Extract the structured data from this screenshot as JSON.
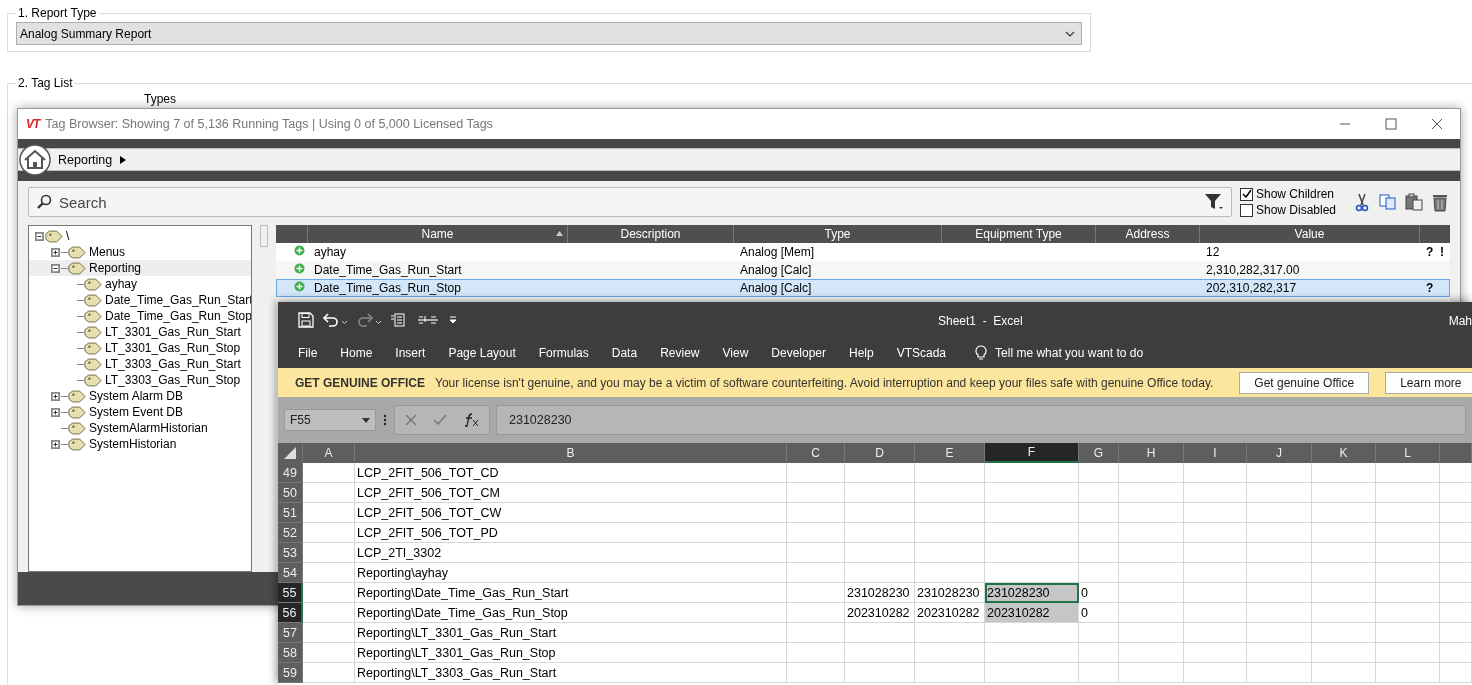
{
  "report_type": {
    "legend": "1. Report Type",
    "value": "Analog Summary Report"
  },
  "tag_list": {
    "legend": "2. Tag List",
    "types_label": "Types"
  },
  "tag_browser": {
    "logo_text": "VT",
    "title": "Tag Browser: Showing 7 of 5,136 Running Tags | Using 0 of 5,000 Licensed Tags",
    "breadcrumb": "Reporting",
    "search": {
      "placeholder": "Search"
    },
    "options": [
      {
        "label": "Show Children",
        "checked": true
      },
      {
        "label": "Show Disabled",
        "checked": false
      }
    ],
    "tree": [
      {
        "label": "\\",
        "expanded": true,
        "selected": false,
        "children": [
          {
            "label": "Menus",
            "expanded": false,
            "selected": false
          },
          {
            "label": "Reporting",
            "expanded": true,
            "selected": true,
            "children": [
              {
                "label": "ayhay",
                "selected": false
              },
              {
                "label": "Date_Time_Gas_Run_Start",
                "selected": false
              },
              {
                "label": "Date_Time_Gas_Run_Stop",
                "selected": false
              },
              {
                "label": "LT_3301_Gas_Run_Start",
                "selected": false
              },
              {
                "label": "LT_3301_Gas_Run_Stop",
                "selected": false
              },
              {
                "label": "LT_3303_Gas_Run_Start",
                "selected": false
              },
              {
                "label": "LT_3303_Gas_Run_Stop",
                "selected": false
              }
            ]
          },
          {
            "label": "System Alarm DB",
            "expanded": false,
            "selected": false
          },
          {
            "label": "System Event DB",
            "expanded": false,
            "selected": false
          },
          {
            "label": "SystemAlarmHistorian",
            "selected": false
          },
          {
            "label": "SystemHistorian",
            "expanded": false,
            "selected": false
          }
        ]
      }
    ],
    "columns": [
      {
        "label": "Name",
        "sorted": true
      },
      {
        "label": "Description",
        "sorted": false
      },
      {
        "label": "Type",
        "sorted": false
      },
      {
        "label": "Equipment Type",
        "sorted": false
      },
      {
        "label": "Address",
        "sorted": false
      },
      {
        "label": "Value",
        "sorted": false
      }
    ],
    "rows": [
      {
        "name": "ayhay",
        "type": "Analog [Mem]",
        "value": "12",
        "flags": [
          "?",
          "!"
        ],
        "selected": false
      },
      {
        "name": "Date_Time_Gas_Run_Start",
        "type": "Analog [Calc]",
        "value": "2,310,282,317.00",
        "flags": [],
        "selected": false
      },
      {
        "name": "Date_Time_Gas_Run_Stop",
        "type": "Analog [Calc]",
        "value": "202,310,282,317",
        "flags": [
          "?"
        ],
        "selected": true
      }
    ]
  },
  "excel": {
    "title": "Sheet1  -  Excel",
    "account": "Mah",
    "menu": [
      "File",
      "Home",
      "Insert",
      "Page Layout",
      "Formulas",
      "Data",
      "Review",
      "View",
      "Developer",
      "Help",
      "VTScada"
    ],
    "tell_me": "Tell me what you want to do",
    "notice": {
      "heading": "GET GENUINE OFFICE",
      "text": "Your license isn't genuine, and you may be a victim of software counterfeiting. Avoid interruption and keep your files safe with genuine Office today.",
      "buttons": [
        "Get genuine Office",
        "Learn more"
      ]
    },
    "name_box": "F55",
    "formula": "231028230",
    "columns": [
      {
        "label": "A",
        "selected": false
      },
      {
        "label": "B",
        "selected": false
      },
      {
        "label": "C",
        "selected": false
      },
      {
        "label": "D",
        "selected": false
      },
      {
        "label": "E",
        "selected": false
      },
      {
        "label": "F",
        "selected": true
      },
      {
        "label": "G",
        "selected": false
      },
      {
        "label": "H",
        "selected": false
      },
      {
        "label": "I",
        "selected": false
      },
      {
        "label": "J",
        "selected": false
      },
      {
        "label": "K",
        "selected": false
      },
      {
        "label": "L",
        "selected": false
      }
    ],
    "rows": [
      {
        "number": "49",
        "selected": false,
        "cells": {
          "B": "LCP_2FIT_506_TOT_CD"
        }
      },
      {
        "number": "50",
        "selected": false,
        "cells": {
          "B": "LCP_2FIT_506_TOT_CM"
        }
      },
      {
        "number": "51",
        "selected": false,
        "cells": {
          "B": "LCP_2FIT_506_TOT_CW"
        }
      },
      {
        "number": "52",
        "selected": false,
        "cells": {
          "B": "LCP_2FIT_506_TOT_PD"
        }
      },
      {
        "number": "53",
        "selected": false,
        "cells": {
          "B": "LCP_2TI_3302"
        }
      },
      {
        "number": "54",
        "selected": false,
        "cells": {
          "B": "Reporting\\ayhay"
        }
      },
      {
        "number": "55",
        "selected": true,
        "active": true,
        "cells": {
          "B": "Reporting\\Date_Time_Gas_Run_Start",
          "D": "231028230",
          "E": "231028230",
          "F": "231028230",
          "G": "0"
        }
      },
      {
        "number": "56",
        "selected": true,
        "active": false,
        "cells": {
          "B": "Reporting\\Date_Time_Gas_Run_Stop",
          "D": "202310282",
          "E": "202310282",
          "F": "202310282",
          "G": "0"
        }
      },
      {
        "number": "57",
        "selected": false,
        "cells": {
          "B": "Reporting\\LT_3301_Gas_Run_Start"
        }
      },
      {
        "number": "58",
        "selected": false,
        "cells": {
          "B": "Reporting\\LT_3301_Gas_Run_Stop"
        }
      },
      {
        "number": "59",
        "selected": false,
        "cells": {
          "B": "Reporting\\LT_3303_Gas_Run_Start"
        }
      }
    ]
  }
}
